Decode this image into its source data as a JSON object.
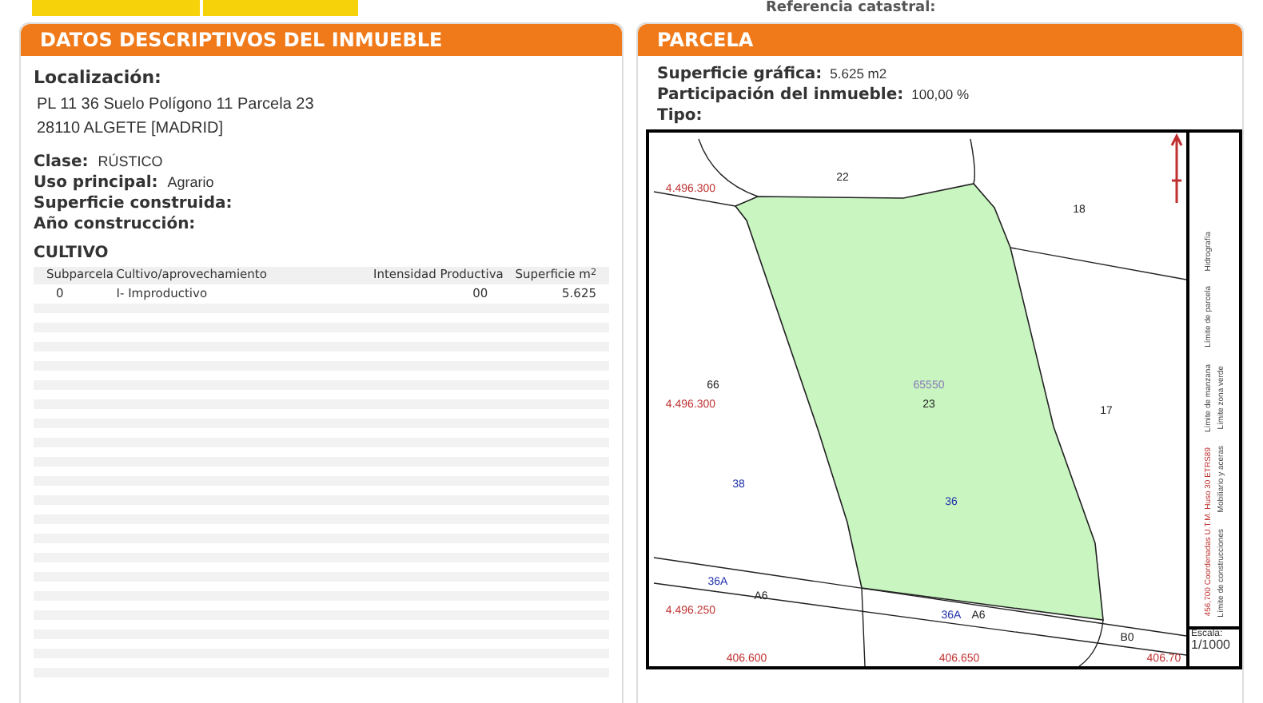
{
  "top_bar": {
    "reference_label": "Referencia catastral:"
  },
  "left_panel": {
    "title": "DATOS DESCRIPTIVOS DEL INMUEBLE",
    "location_label": "Localización:",
    "address_lines": [
      "PL 11 36 Suelo Polígono 11 Parcela 23",
      "28110 ALGETE [MADRID]"
    ],
    "fields": [
      {
        "label": "Clase:",
        "value": "RÚSTICO"
      },
      {
        "label": "Uso principal:",
        "value": "Agrario"
      },
      {
        "label": "Superficie construida:"
      },
      {
        "label": "Año construcción:"
      }
    ],
    "cultivo": {
      "title": "CULTIVO",
      "columns": [
        "Subparcela",
        "Cultivo/aprovechamiento",
        "Intensidad Productiva",
        "Superficie m$^{2}$"
      ],
      "rows": [
        [
          "0",
          "I- Improductivo",
          "00",
          "5.625"
        ]
      ]
    }
  },
  "right_panel": {
    "title": "PARCELA",
    "fields": [
      {
        "label": "Superficie gráfica:",
        "value": "5.625 m2"
      },
      {
        "label": "Participación del inmueble:",
        "value": "100,00 %"
      },
      {
        "label": "Tipo:"
      }
    ],
    "map": {
      "labels": [
        {
          "text": "22",
          "kind": "parcel"
        },
        {
          "text": "18",
          "kind": "parcel"
        },
        {
          "text": "65550",
          "kind": "polygon"
        },
        {
          "text": "23",
          "kind": "parcel"
        },
        {
          "text": "17",
          "kind": "parcel"
        },
        {
          "text": "66",
          "kind": "parcel"
        },
        {
          "text": "38",
          "kind": "subparcel"
        },
        {
          "text": "36",
          "kind": "subparcel"
        },
        {
          "text": "36A",
          "kind": "subparcel"
        },
        {
          "text": "A6",
          "kind": "parcel"
        },
        {
          "text": "36A",
          "kind": "subparcel"
        },
        {
          "text": "A6",
          "kind": "parcel"
        },
        {
          "text": "B0",
          "kind": "parcel"
        },
        {
          "text": "4.496.300",
          "kind": "coordinate"
        },
        {
          "text": "4.496.300",
          "kind": "coordinate"
        },
        {
          "text": "4.496.250",
          "kind": "coordinate"
        },
        {
          "text": "406.600",
          "kind": "coordinate"
        },
        {
          "text": "406.650",
          "kind": "coordinate"
        },
        {
          "text": "406.70",
          "kind": "coordinate"
        }
      ],
      "legend": [
        "Límite de manzana",
        "Límite de construcciones",
        "Límite de parcela",
        "Mobiliario y aceras",
        "Hidrografía",
        "Límite zona verde"
      ],
      "coordinates_note": "456,700 Coordenadas U.T.M. Huso 30 ETRS89",
      "scale_label": "Escala:",
      "scale_value": "1/1000"
    }
  }
}
